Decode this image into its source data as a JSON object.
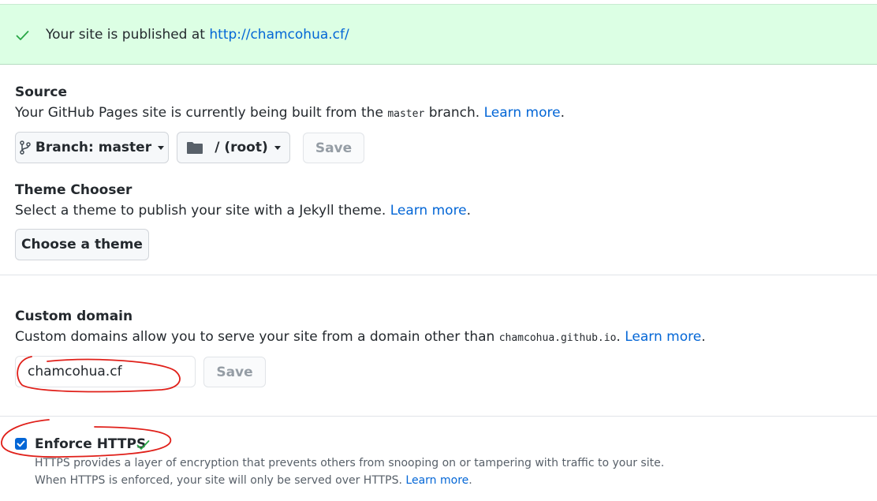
{
  "banner": {
    "text": "Your site is published at ",
    "url": "http://chamcohua.cf/"
  },
  "source": {
    "heading": "Source",
    "desc_prefix": "Your GitHub Pages site is currently being built from the ",
    "branch_code": "master",
    "desc_suffix": " branch. ",
    "learn_more": "Learn more",
    "period": ".",
    "branch_button": "Branch: master",
    "folder_button": "/ (root)",
    "save_button": "Save"
  },
  "theme": {
    "heading": "Theme Chooser",
    "desc": "Select a theme to publish your site with a Jekyll theme. ",
    "learn_more": "Learn more",
    "period": ".",
    "choose_button": "Choose a theme"
  },
  "custom_domain": {
    "heading": "Custom domain",
    "desc_prefix": "Custom domains allow you to serve your site from a domain other than ",
    "domain_code": "chamcohua.github.io",
    "desc_suffix": ". ",
    "learn_more": "Learn more",
    "period": ".",
    "input_value": "chamcohua.cf",
    "save_button": "Save"
  },
  "https": {
    "label": "Enforce HTTPS",
    "checked": true,
    "desc_line1": "HTTPS provides a layer of encryption that prevents others from snooping on or tampering with traffic to your site.",
    "desc_line2": "When HTTPS is enforced, your site will only be served over HTTPS. ",
    "learn_more": "Learn more",
    "period": "."
  },
  "colors": {
    "banner_bg": "#dcffe4",
    "link": "#0366d6",
    "success_check": "#28a745",
    "annotation": "#e0201a"
  }
}
